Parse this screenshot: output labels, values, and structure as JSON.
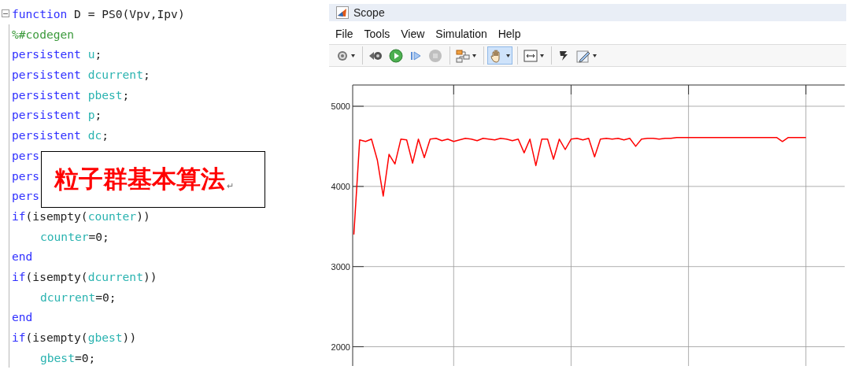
{
  "editor": {
    "lines": [
      {
        "tokens": [
          {
            "kind": "keyword",
            "text": "function"
          },
          {
            "kind": "plain",
            "text": " D = PS0(Vpv,Ipv)"
          }
        ]
      },
      {
        "tokens": [
          {
            "kind": "comment",
            "text": "%#codegen"
          }
        ]
      },
      {
        "tokens": [
          {
            "kind": "keyword",
            "text": "persistent "
          },
          {
            "kind": "variable",
            "text": "u"
          },
          {
            "kind": "plain",
            "text": ";"
          }
        ]
      },
      {
        "tokens": [
          {
            "kind": "keyword",
            "text": "persistent "
          },
          {
            "kind": "variable",
            "text": "dcurrent"
          },
          {
            "kind": "plain",
            "text": ";"
          }
        ]
      },
      {
        "tokens": [
          {
            "kind": "keyword",
            "text": "persistent "
          },
          {
            "kind": "variable",
            "text": "pbest"
          },
          {
            "kind": "plain",
            "text": ";"
          }
        ]
      },
      {
        "tokens": [
          {
            "kind": "keyword",
            "text": "persistent "
          },
          {
            "kind": "variable",
            "text": "p"
          },
          {
            "kind": "plain",
            "text": ";"
          }
        ]
      },
      {
        "tokens": [
          {
            "kind": "keyword",
            "text": "persistent "
          },
          {
            "kind": "variable",
            "text": "dc"
          },
          {
            "kind": "plain",
            "text": ";"
          }
        ]
      },
      {
        "tokens": [
          {
            "kind": "keyword",
            "text": "pers"
          }
        ]
      },
      {
        "tokens": [
          {
            "kind": "keyword",
            "text": "pers"
          }
        ]
      },
      {
        "tokens": [
          {
            "kind": "keyword",
            "text": "pers"
          }
        ]
      },
      {
        "tokens": [
          {
            "kind": "keyword",
            "text": "if"
          },
          {
            "kind": "plain",
            "text": "(isempty("
          },
          {
            "kind": "variable",
            "text": "counter"
          },
          {
            "kind": "plain",
            "text": "))"
          }
        ],
        "children": [
          {
            "tokens": [
              {
                "kind": "variable",
                "text": "counter"
              },
              {
                "kind": "plain",
                "text": "=0;"
              }
            ]
          }
        ]
      },
      {
        "tokens": [
          {
            "kind": "keyword",
            "text": "end"
          }
        ]
      },
      {
        "tokens": [
          {
            "kind": "keyword",
            "text": "if"
          },
          {
            "kind": "plain",
            "text": "(isempty("
          },
          {
            "kind": "variable",
            "text": "dcurrent"
          },
          {
            "kind": "plain",
            "text": "))"
          }
        ],
        "children": [
          {
            "tokens": [
              {
                "kind": "variable",
                "text": "dcurrent"
              },
              {
                "kind": "plain",
                "text": "=0;"
              }
            ]
          }
        ]
      },
      {
        "tokens": [
          {
            "kind": "keyword",
            "text": "end"
          }
        ]
      },
      {
        "tokens": [
          {
            "kind": "keyword",
            "text": "if"
          },
          {
            "kind": "plain",
            "text": "(isempty("
          },
          {
            "kind": "variable",
            "text": "gbest"
          },
          {
            "kind": "plain",
            "text": "))"
          }
        ],
        "children": [
          {
            "tokens": [
              {
                "kind": "variable",
                "text": "gbest"
              },
              {
                "kind": "plain",
                "text": "=0;"
              }
            ]
          }
        ]
      }
    ],
    "text_box": {
      "text": "粒子群基本算法",
      "mark": "↵"
    }
  },
  "scope": {
    "title": "Scope",
    "menu": [
      "File",
      "Tools",
      "View",
      "Simulation",
      "Help"
    ],
    "toolbar": [
      [
        {
          "selected": false,
          "disabled": false,
          "dropdown": true
        }
      ],
      [
        {
          "selected": false,
          "disabled": false,
          "dropdown": false
        },
        {
          "selected": false,
          "disabled": false,
          "dropdown": false
        },
        {
          "selected": false,
          "disabled": false,
          "dropdown": false
        },
        {
          "selected": false,
          "disabled": true,
          "dropdown": false
        }
      ],
      [
        {
          "selected": false,
          "disabled": false,
          "dropdown": true
        }
      ],
      [
        {
          "selected": true,
          "disabled": false,
          "dropdown": true
        }
      ],
      [
        {
          "selected": false,
          "disabled": false,
          "dropdown": true
        }
      ],
      [
        {
          "selected": false,
          "disabled": false,
          "dropdown": false
        },
        {
          "selected": false,
          "disabled": false,
          "dropdown": true
        }
      ]
    ],
    "chart_data": {
      "type": "line",
      "grid": true,
      "ylim": [
        1760,
        5265
      ],
      "yticks": [
        2000,
        3000,
        4000,
        5000
      ],
      "categories": [
        null,
        null,
        null,
        null,
        null,
        null,
        null,
        null,
        null,
        null,
        null,
        null,
        null,
        null,
        null,
        null,
        null,
        null,
        null,
        null,
        null,
        null,
        null,
        null,
        null,
        null,
        null,
        null,
        null,
        null,
        null,
        null,
        null,
        null,
        null,
        null,
        null,
        null,
        null,
        null,
        null,
        null,
        null,
        null,
        null,
        null,
        null,
        null,
        null,
        null,
        null,
        null,
        null,
        null,
        null,
        null,
        null,
        null,
        null,
        null,
        null,
        null,
        null,
        null,
        null,
        null,
        null,
        null,
        null,
        null,
        null,
        null,
        null,
        null,
        null,
        null,
        null,
        null
      ],
      "series": [
        {
          "color": "#ff0000",
          "values": [
            3400,
            4580,
            4560,
            4590,
            4330,
            3880,
            4400,
            4280,
            4590,
            4580,
            4290,
            4590,
            4360,
            4590,
            4600,
            4570,
            4590,
            4560,
            4580,
            4600,
            4590,
            4570,
            4600,
            4590,
            4580,
            4600,
            4590,
            4570,
            4590,
            4420,
            4590,
            4260,
            4590,
            4590,
            4340,
            4590,
            4460,
            4590,
            4600,
            4580,
            4600,
            4370,
            4590,
            4600,
            4590,
            4600,
            4580,
            4600,
            4500,
            4590,
            4600,
            4600,
            4590,
            4600,
            4600,
            4610,
            4610,
            4610,
            4610,
            4610,
            4610,
            4610,
            4610,
            4610,
            4610,
            4610,
            4610,
            4610,
            4610,
            4610,
            4610,
            4610,
            4610,
            4560,
            4610,
            4610,
            4610,
            4610
          ]
        }
      ]
    }
  }
}
